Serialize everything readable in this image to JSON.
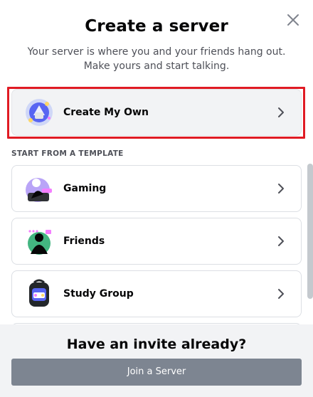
{
  "modal": {
    "title": "Create a server",
    "subtitle": "Your server is where you and your friends hang out. Make yours and start talking.",
    "close_icon": "close-icon"
  },
  "primary_option": {
    "label": "Create My Own",
    "icon": "create-server-illustration",
    "chevron": "chevron-right-icon",
    "highlight_color": "#e01b24"
  },
  "templates": {
    "header": "START FROM A TEMPLATE",
    "items": [
      {
        "label": "Gaming",
        "icon": "gaming-illustration"
      },
      {
        "label": "Friends",
        "icon": "friends-illustration"
      },
      {
        "label": "Study Group",
        "icon": "study-group-illustration"
      }
    ]
  },
  "footer": {
    "title": "Have an invite already?",
    "button_label": "Join a Server"
  },
  "colors": {
    "text_primary": "#060607",
    "text_muted": "#4e5058",
    "footer_bg": "#f2f3f5",
    "button_bg": "#7d8591"
  }
}
